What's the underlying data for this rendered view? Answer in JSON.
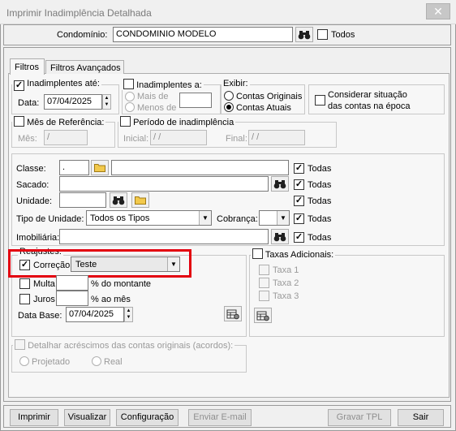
{
  "window": {
    "title": "Imprimir Inadimplência Detalhada",
    "close_glyph": "✕"
  },
  "condominio": {
    "label": "Condomínio:",
    "value": "CONDOMINIO MODELO",
    "todos_label": "Todos"
  },
  "tabs": [
    {
      "label": "Filtros"
    },
    {
      "label": "Filtros Avançados"
    }
  ],
  "inadimplentes_ate": {
    "label": "Inadimplentes até:",
    "data_label": "Data:",
    "date": "07/04/2025"
  },
  "inadimplentes_a": {
    "label": "Inadimplentes a:",
    "mais_de": "Mais de",
    "menos_de": "Menos de"
  },
  "exibir": {
    "label": "Exibir:",
    "contas_originais": "Contas Originais",
    "contas_atuais": "Contas Atuais"
  },
  "considerar": {
    "line1": "Considerar situação",
    "line2": "das contas na época"
  },
  "mes_referencia": {
    "label": "Mês de Referência:",
    "mes_label": "Mês:",
    "mes_value": "  /"
  },
  "periodo": {
    "label": "Período de inadimplência",
    "inicial_label": "Inicial:",
    "inicial_value": " / /",
    "final_label": "Final:",
    "final_value": " / /"
  },
  "filters": {
    "classe_label": "Classe:",
    "classe_value": ".",
    "sacado_label": "Sacado:",
    "unidade_label": "Unidade:",
    "tipo_unidade_label": "Tipo de Unidade:",
    "tipo_unidade_value": "Todos os Tipos",
    "cobranca_label": "Cobrança:",
    "imobiliaria_label": "Imobiliária:",
    "todas_label": "Todas"
  },
  "reajustes": {
    "label": "Reajustes:",
    "correcao_label": "Correção",
    "correcao_value": "Teste",
    "multa_label": "Multa",
    "multa_suffix": "% do montante",
    "juros_label": "Juros",
    "juros_suffix": "% ao mês",
    "data_base_label": "Data Base:",
    "data_base_value": "07/04/2025"
  },
  "taxas": {
    "label": "Taxas Adicionais:",
    "items": [
      "Taxa 1",
      "Taxa 2",
      "Taxa 3"
    ]
  },
  "detalhar": {
    "label": "Detalhar acréscimos das contas originais (acordos):",
    "projetado": "Projetado",
    "real": "Real"
  },
  "buttons": {
    "imprimir": "Imprimir",
    "visualizar": "Visualizar",
    "configuracao": "Configuração",
    "enviar_email": "Enviar E-mail",
    "gravar_tpl": "Gravar TPL",
    "sair": "Sair"
  },
  "colors": {
    "highlight": "#e3000f",
    "folder": "#f2c94c",
    "binoculars": "#1f1f1f"
  }
}
